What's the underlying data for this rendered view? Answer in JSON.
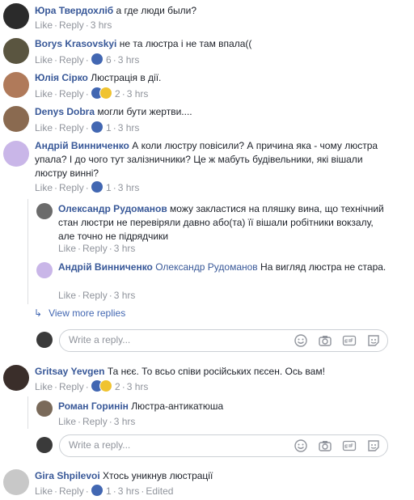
{
  "comments": [
    {
      "name": "Юра Твердохліб",
      "text": "а где люди были?",
      "like": "Like",
      "reply": "Reply",
      "time": "3 hrs"
    },
    {
      "name": "Borys Krasovskyi",
      "text": "не та люстра і не там впала((",
      "like": "Like",
      "reply": "Reply",
      "reactions": "6",
      "time": "3 hrs"
    },
    {
      "name": "Юлія Сірко",
      "text": "Люстрація в дії.",
      "like": "Like",
      "reply": "Reply",
      "reactions": "2",
      "time": "3 hrs"
    },
    {
      "name": "Denys Dobra",
      "text": "могли бути жертви....",
      "like": "Like",
      "reply": "Reply",
      "reactions": "1",
      "time": "3 hrs"
    },
    {
      "name": "Андрій Винниченко",
      "text": "А коли люстру повісили? А причина яка - чому люстра упала? І до чого тут залізничники? Це ж мабуть будівельники, які вішали люстру винні?",
      "like": "Like",
      "reply": "Reply",
      "reactions": "1",
      "time": "3 hrs"
    }
  ],
  "replies1": [
    {
      "name": "Олександр Рудоманов",
      "text": "можу закластися на пляшку вина, що технічний стан люстри не перевіряли давно або(та) її вішали робітники вокзалу, але точно не підрядчики",
      "like": "Like",
      "reply": "Reply",
      "time": "3 hrs"
    },
    {
      "name": "Андрій Винниченко",
      "mention": "Олександр Рудоманов",
      "text": "На вигляд люстра не стара.",
      "like": "Like",
      "reply": "Reply",
      "time": "3 hrs"
    }
  ],
  "view_more": "View more replies",
  "reply_placeholder": "Write a reply...",
  "comment6": {
    "name": "Gritsay Yevgen",
    "text": "Та нєє. То всьо співи російських пєсен. Ось вам!",
    "like": "Like",
    "reply": "Reply",
    "reactions": "2",
    "time": "3 hrs"
  },
  "reply2": {
    "name": "Роман Горинін",
    "text": "Люстра-антикатюша",
    "like": "Like",
    "reply": "Reply",
    "time": "3 hrs"
  },
  "comment7": {
    "name": "Gira Shpilevoi",
    "text": "Хтось уникнув люстрації",
    "like": "Like",
    "reply": "Reply",
    "reactions": "1",
    "time": "3 hrs",
    "edited": "Edited"
  },
  "colors": {
    "link": "#385898",
    "meta": "#90949c",
    "like_blue": "#4267b2",
    "haha": "#f0c330"
  }
}
